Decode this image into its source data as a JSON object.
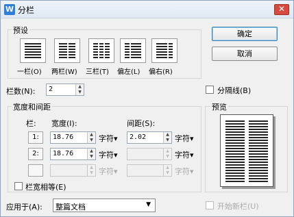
{
  "window": {
    "title": "分栏",
    "app_icon": "wps-writer-icon"
  },
  "presets": {
    "group_label": "预设",
    "items": [
      {
        "label": "一栏(O)",
        "icon": "one-column-icon"
      },
      {
        "label": "两栏(W)",
        "icon": "two-columns-icon"
      },
      {
        "label": "三栏(T)",
        "icon": "three-columns-icon"
      },
      {
        "label": "偏左(L)",
        "icon": "left-column-icon"
      },
      {
        "label": "偏右(R)",
        "icon": "right-column-icon"
      }
    ]
  },
  "buttons": {
    "ok": "确定",
    "cancel": "取消"
  },
  "column_count": {
    "label": "栏数(N):",
    "value": "2"
  },
  "separator": {
    "label": "分隔线(B)",
    "checked": false
  },
  "width_spacing": {
    "group_label": "宽度和间距",
    "headers": {
      "col": "栏:",
      "width": "宽度(I):",
      "spacing": "间距(S):"
    },
    "rows": [
      {
        "index": "1:",
        "width": "18.76",
        "width_unit": "字符▾",
        "spacing": "2.02",
        "spacing_unit": "字符▾",
        "enabled": true
      },
      {
        "index": "2:",
        "width": "18.76",
        "width_unit": "字符▾",
        "spacing": "",
        "spacing_unit": "字符▾",
        "enabled": true
      },
      {
        "index": "",
        "width": "",
        "width_unit": "字符▾",
        "spacing": "",
        "spacing_unit": "字符▾",
        "enabled": false
      }
    ],
    "equal_width": {
      "label": "栏宽相等(E)",
      "checked": false
    }
  },
  "preview": {
    "label": "预览",
    "columns": 2
  },
  "apply_to": {
    "label": "应用于(A):",
    "value": "整篇文档"
  },
  "new_column": {
    "label": "开始新栏(U)",
    "checked": false,
    "enabled": false
  }
}
